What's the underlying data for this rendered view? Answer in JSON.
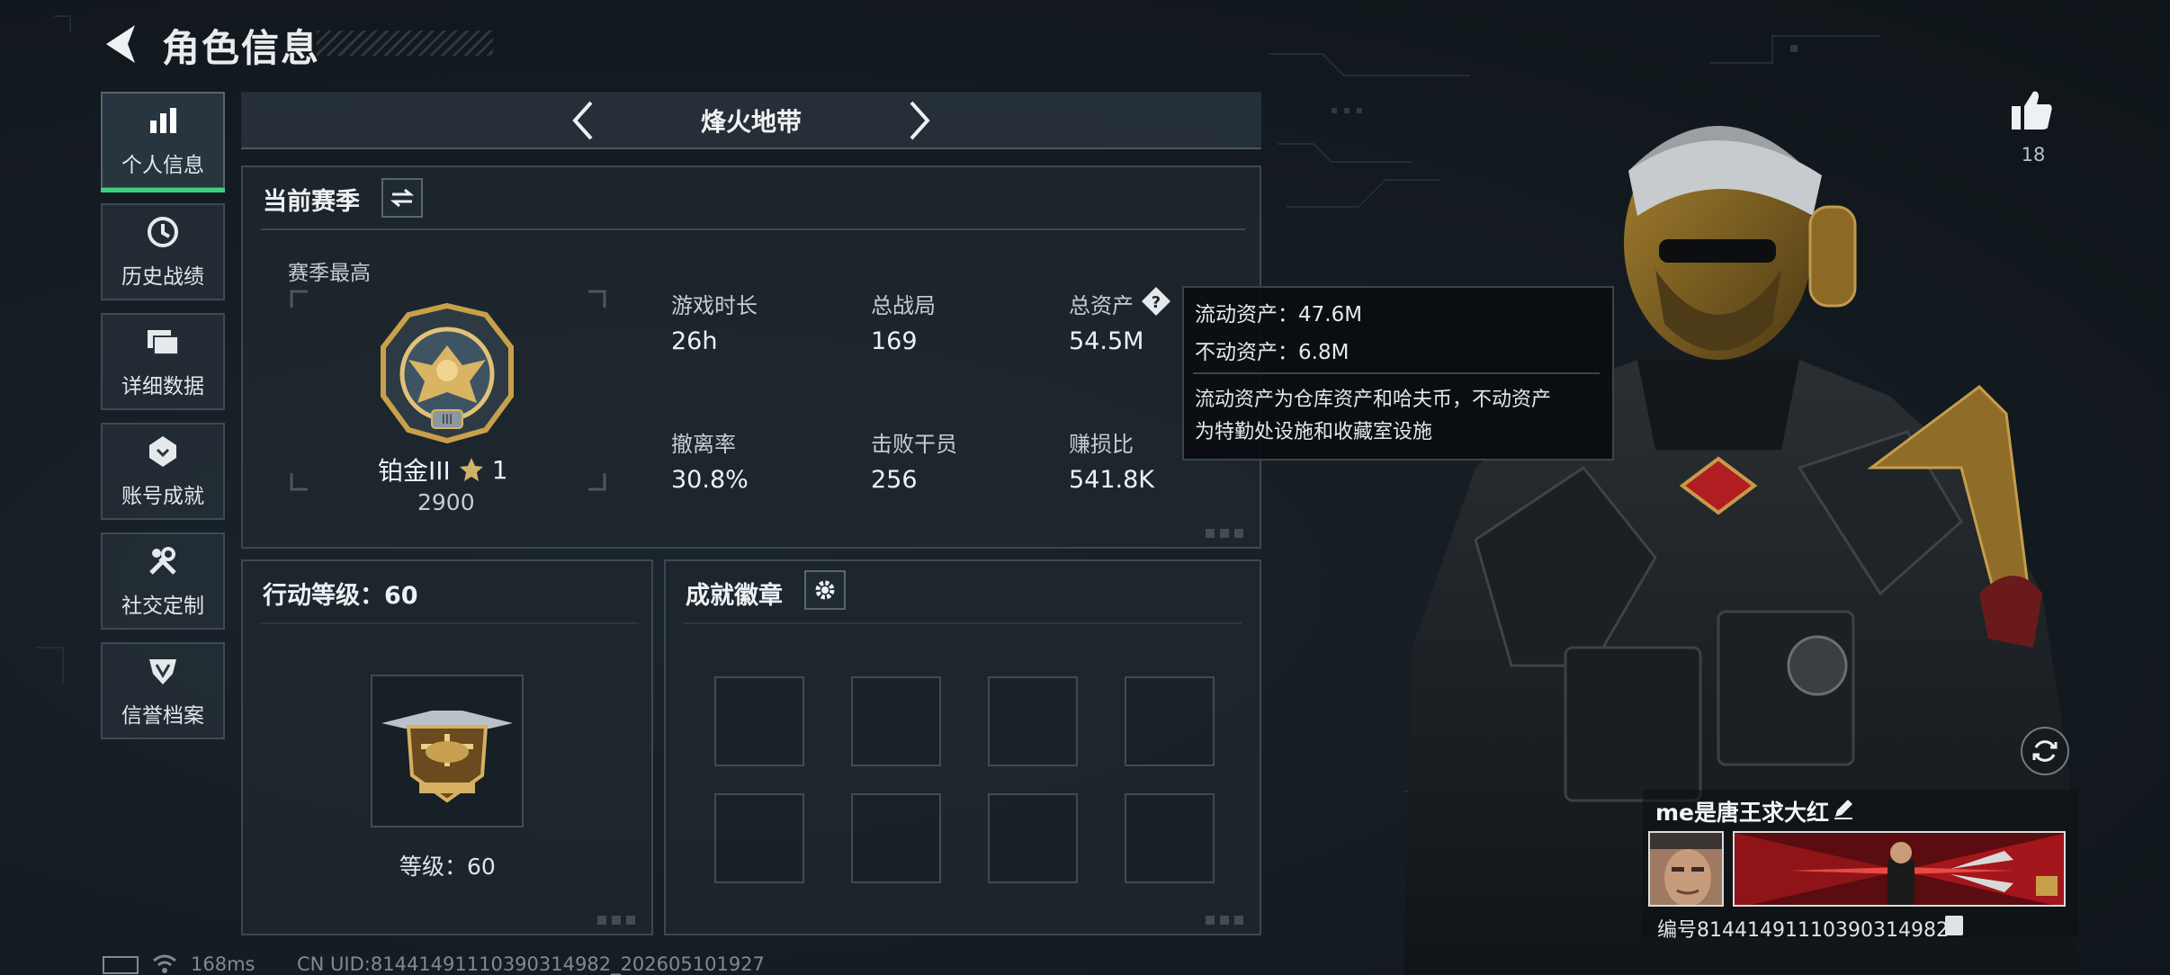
{
  "header": {
    "title": "角色信息"
  },
  "sidebar": {
    "items": [
      {
        "label": "个人信息",
        "icon": "bar-chart-icon",
        "active": true
      },
      {
        "label": "历史战绩",
        "icon": "history-clock-icon"
      },
      {
        "label": "详细数据",
        "icon": "folder-icon"
      },
      {
        "label": "账号成就",
        "icon": "achievement-icon"
      },
      {
        "label": "社交定制",
        "icon": "wrench-icon"
      },
      {
        "label": "信誉档案",
        "icon": "shield-icon"
      }
    ]
  },
  "mode": {
    "name": "烽火地带"
  },
  "season": {
    "title": "当前赛季",
    "best_label": "赛季最高",
    "rank_name": "铂金III",
    "rank_stars": "1",
    "rank_points": "2900",
    "stats": [
      {
        "label": "游戏时长",
        "value": "26h"
      },
      {
        "label": "总战局",
        "value": "169"
      },
      {
        "label": "总资产",
        "value": "54.5M"
      },
      {
        "label": "撤离率",
        "value": "30.8%"
      },
      {
        "label": "击败干员",
        "value": "256"
      },
      {
        "label": "赚损比",
        "value": "541.8K"
      }
    ]
  },
  "tooltip": {
    "liquid": "流动资产：47.6M",
    "fixed": "不动资产：6.8M",
    "desc_line1": "流动资产为仓库资产和哈夫币，不动资产",
    "desc_line2": "为特勤处设施和收藏室设施"
  },
  "action_level": {
    "title": "行动等级：60",
    "level_label": "等级：60"
  },
  "badges": {
    "title": "成就徽章",
    "slots": 8
  },
  "profile": {
    "likes": "18",
    "name": "me是唐王求大红",
    "id_text": "编号8144149111039031498​2"
  },
  "status": {
    "ping": "168ms",
    "uid": "CN UID:8144149111039031498​2_202605101927"
  },
  "colors": {
    "accent_green": "#3cd27c",
    "gold": "#c9a04a",
    "tooltip_bg": "#0a0d10"
  }
}
